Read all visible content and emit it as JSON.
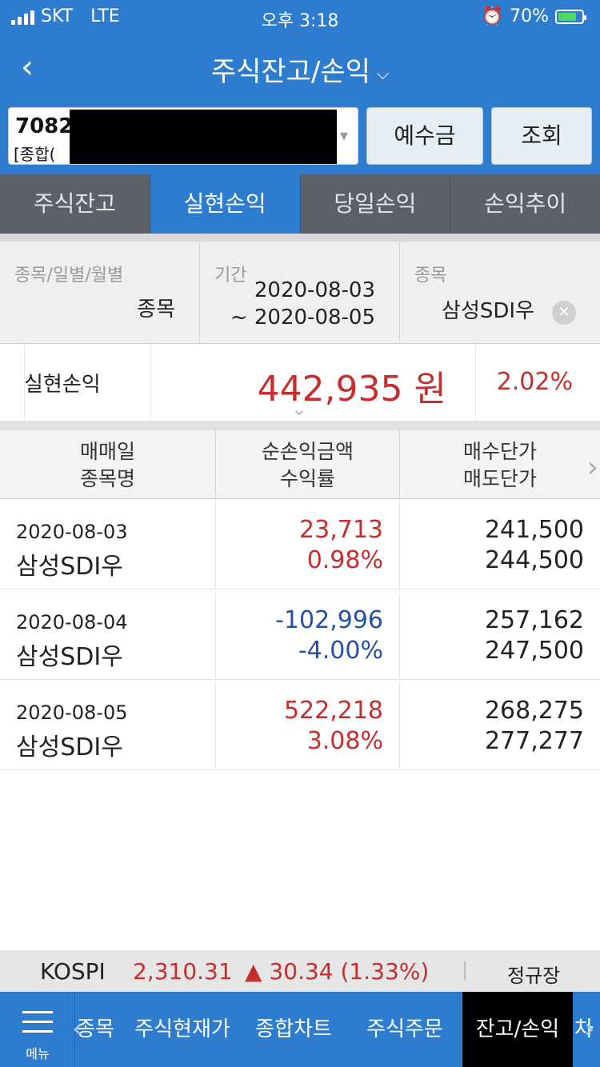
{
  "status_bar": {
    "carrier": "SKT",
    "network": "LTE",
    "time": "오후 3:18",
    "battery": "70%"
  },
  "header": {
    "title": "주식잔고/손익"
  },
  "account": {
    "number": "7082",
    "name": "[종합(",
    "deposit_button": "예수금",
    "inquiry_button": "조회"
  },
  "tabs": [
    {
      "label": "주식잔고"
    },
    {
      "label": "실현손익"
    },
    {
      "label": "당일손익"
    },
    {
      "label": "손익추이"
    }
  ],
  "active_tab": "실현손익",
  "filter": {
    "type_label": "종목/일별/월별",
    "type_value": "종목",
    "period_label": "기간",
    "period_from": "2020-08-03",
    "period_to": "~ 2020-08-05",
    "stock_label": "종목",
    "stock_value": "삼성SDI우"
  },
  "summary": {
    "label": "실현손익",
    "amount": "442,935 원",
    "rate": "2.02%"
  },
  "table": {
    "headers": [
      {
        "line1": "매매일",
        "line2": "종목명"
      },
      {
        "line1": "순손익금액",
        "line2": "수익률"
      },
      {
        "line1": "매수단가",
        "line2": "매도단가"
      }
    ],
    "rows": [
      {
        "date": "2020-08-03",
        "name": "삼성SDI우",
        "profit": "23,713",
        "rate": "0.98%",
        "buy_price": "241,500",
        "sell_price": "244,500"
      },
      {
        "date": "2020-08-04",
        "name": "삼성SDI우",
        "profit": "-102,996",
        "rate": "-4.00%",
        "buy_price": "257,162",
        "sell_price": "247,500"
      },
      {
        "date": "2020-08-05",
        "name": "삼성SDI우",
        "profit": "522,218",
        "rate": "3.08%",
        "buy_price": "268,275",
        "sell_price": "277,277"
      }
    ]
  },
  "ticker": {
    "index": "KOSPI",
    "value": "2,310.31",
    "change": "▲ 30.34 (1.33%)",
    "session": "정규장"
  },
  "bottom_nav": {
    "menu_label": "메뉴",
    "items": [
      {
        "label": "종목"
      },
      {
        "label": "주식현재가"
      },
      {
        "label": "종합차트"
      },
      {
        "label": "주식주문"
      },
      {
        "label": "잔고/손익"
      },
      {
        "label": "차"
      }
    ]
  },
  "colors": {
    "primary": "#2d7ccf",
    "profit": "#c62d2d",
    "loss": "#2650a8",
    "active_nav": "#000000"
  }
}
